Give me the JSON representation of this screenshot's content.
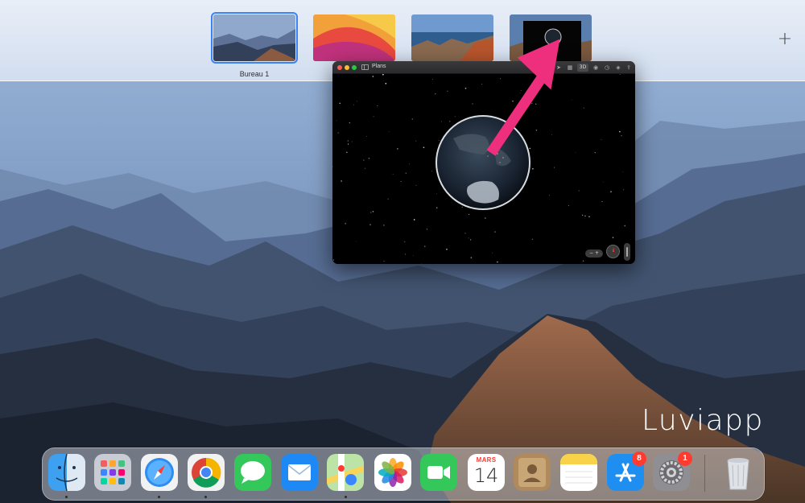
{
  "spaces": {
    "items": [
      {
        "label": "Bureau 1",
        "selected": true
      },
      {
        "label": ""
      },
      {
        "label": ""
      },
      {
        "label": ""
      }
    ],
    "add_label": "+"
  },
  "maps_window": {
    "title": "Plans",
    "toolbar": {
      "location_icon": "location-arrow-icon",
      "map_mode_icon": "map-icon",
      "mode_3d_label": "3D",
      "look_around_icon": "binoculars-icon",
      "zoom_icon": "clock-icon",
      "directions_icon": "directions-icon",
      "share_icon": "share-icon"
    },
    "zoom_control_label": "− +",
    "compass_icon": "compass-icon"
  },
  "annotation": {
    "color": "#ee2f7d"
  },
  "watermark": "Luviapp",
  "dock": {
    "apps": [
      {
        "name": "Finder",
        "icon": "finder-icon"
      },
      {
        "name": "Launchpad",
        "icon": "launchpad-icon"
      },
      {
        "name": "Safari",
        "icon": "safari-icon"
      },
      {
        "name": "Chrome",
        "icon": "chrome-icon"
      },
      {
        "name": "Messages",
        "icon": "messages-icon"
      },
      {
        "name": "Mail",
        "icon": "mail-icon"
      },
      {
        "name": "Plans",
        "icon": "maps-icon"
      },
      {
        "name": "Photos",
        "icon": "photos-icon"
      },
      {
        "name": "FaceTime",
        "icon": "facetime-icon"
      },
      {
        "name": "Calendrier",
        "icon": "calendar-icon",
        "month": "MARS",
        "day": "14"
      },
      {
        "name": "Contacts",
        "icon": "contacts-icon"
      },
      {
        "name": "Notes",
        "icon": "notes-icon"
      },
      {
        "name": "App Store",
        "icon": "app-store-icon",
        "badge": "8"
      },
      {
        "name": "Préférences Système",
        "icon": "system-preferences-icon",
        "badge": "1"
      },
      {
        "name": "Corbeille",
        "icon": "trash-icon"
      }
    ]
  },
  "colors": {
    "selected_space_outline": "#3b82f6",
    "badge": "#ff3b30",
    "arrow": "#ee2f7d"
  }
}
